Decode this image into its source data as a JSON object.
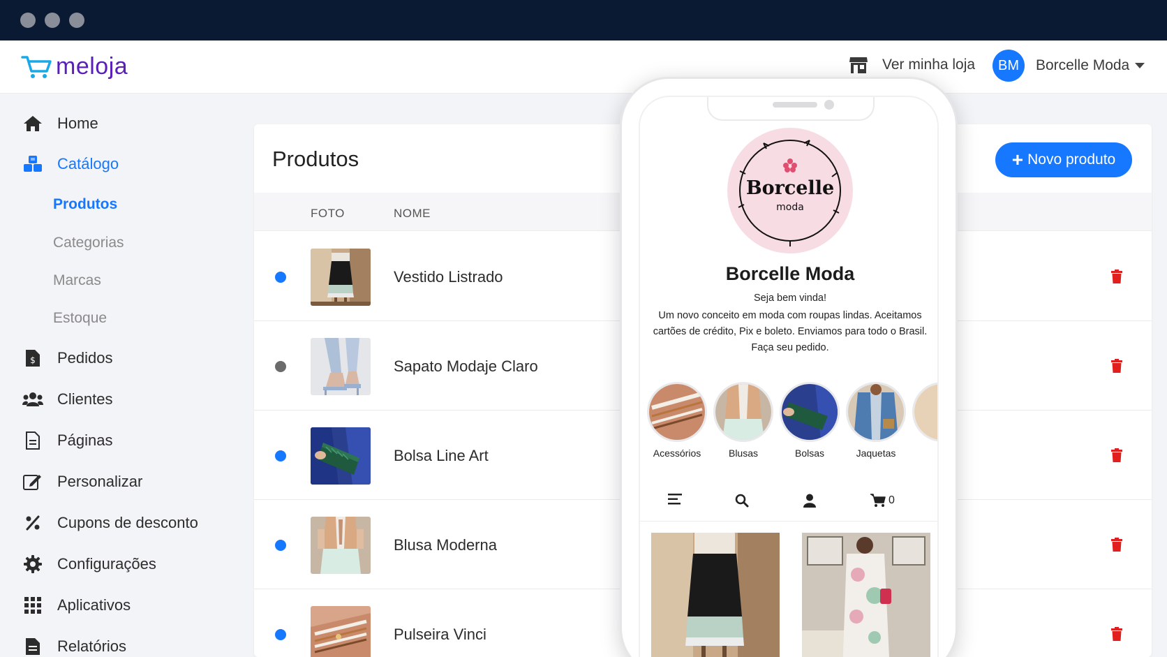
{
  "app": {
    "logo_text": "meloja"
  },
  "header": {
    "store_link_label": "Ver minha loja",
    "avatar_initials": "BM",
    "user_name": "Borcelle Moda"
  },
  "sidebar": {
    "items": [
      {
        "label": "Home",
        "icon": "home-icon"
      },
      {
        "label": "Catálogo",
        "icon": "cubes-icon"
      },
      {
        "label": "Pedidos",
        "icon": "invoice-icon"
      },
      {
        "label": "Clientes",
        "icon": "users-icon"
      },
      {
        "label": "Páginas",
        "icon": "file-icon"
      },
      {
        "label": "Personalizar",
        "icon": "edit-icon"
      },
      {
        "label": "Cupons de desconto",
        "icon": "percent-icon"
      },
      {
        "label": "Configurações",
        "icon": "gear-icon"
      },
      {
        "label": "Aplicativos",
        "icon": "grid-icon"
      },
      {
        "label": "Relatórios",
        "icon": "report-icon"
      }
    ],
    "sub_items": [
      {
        "label": "Produtos",
        "active": true
      },
      {
        "label": "Categorias"
      },
      {
        "label": "Marcas"
      },
      {
        "label": "Estoque"
      }
    ]
  },
  "main": {
    "title": "Produtos",
    "new_button_label": "Novo produto",
    "columns": [
      "FOTO",
      "NOME"
    ],
    "products": [
      {
        "name": "Vestido Listrado",
        "status_color": "#1677ff"
      },
      {
        "name": "Sapato Modaje Claro",
        "status_color": "#6b6b6b"
      },
      {
        "name": "Bolsa Line Art",
        "status_color": "#1677ff"
      },
      {
        "name": "Blusa Moderna",
        "status_color": "#1677ff"
      },
      {
        "name": "Pulseira Vinci",
        "status_color": "#1677ff"
      }
    ]
  },
  "phone": {
    "logo_title": "Borcelle",
    "logo_subtitle": "moda",
    "store_name": "Borcelle Moda",
    "welcome": "Seja bem vinda!",
    "description": "Um novo conceito em moda com roupas lindas. Aceitamos cartões de crédito, Pix e boleto. Enviamos para todo o Brasil. Faça seu pedido.",
    "categories": [
      "Acessórios",
      "Blusas",
      "Bolsas",
      "Jaquetas"
    ],
    "cart_count": "0"
  },
  "colors": {
    "accent": "#1677ff",
    "brand": "#5a1fb8",
    "danger": "#e0201f",
    "chrome": "#0b1a33"
  }
}
